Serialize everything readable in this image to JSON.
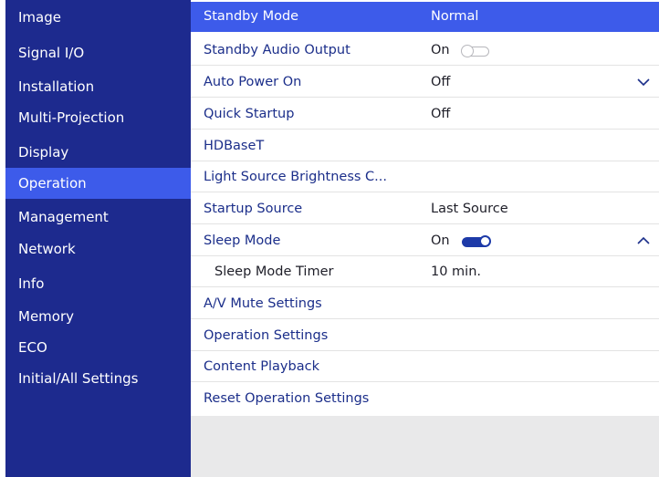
{
  "sidebar": {
    "items": [
      {
        "label": "Image"
      },
      {
        "label": "Signal I/O"
      },
      {
        "label": "Installation"
      },
      {
        "label": "Multi-Projection"
      },
      {
        "label": "Display"
      },
      {
        "label": "Operation",
        "active": true
      },
      {
        "label": "Management"
      },
      {
        "label": "Network"
      },
      {
        "label": "Info"
      },
      {
        "label": "Memory"
      },
      {
        "label": "ECO"
      },
      {
        "label": "Initial/All Settings"
      }
    ]
  },
  "main": {
    "rows": [
      {
        "label": "Standby Mode",
        "value": "Normal",
        "selected": true
      },
      {
        "label": "Standby Audio Output",
        "value": "On",
        "toggle": "off"
      },
      {
        "label": "Auto Power On",
        "value": "Off",
        "icon": "chevron-down-icon"
      },
      {
        "label": "Quick Startup",
        "value": "Off"
      },
      {
        "label": "HDBaseT",
        "value": ""
      },
      {
        "label": "Light Source Brightness C...",
        "value": ""
      },
      {
        "label": "Startup Source",
        "value": "Last Source"
      },
      {
        "label": "Sleep Mode",
        "value": "On",
        "toggle": "on",
        "icon": "chevron-up-icon"
      },
      {
        "label": "Sleep Mode Timer",
        "value": "10 min.",
        "sub": true
      },
      {
        "label": "A/V Mute Settings",
        "value": ""
      },
      {
        "label": "Operation Settings",
        "value": ""
      },
      {
        "label": "Content Playback",
        "value": ""
      },
      {
        "label": "Reset Operation Settings",
        "value": ""
      }
    ]
  },
  "colors": {
    "sidebar_bg": "#1d2a8e",
    "highlight": "#3d5bea",
    "label_text": "#1b2e8a",
    "toggle_on": "#1d3aa8"
  }
}
